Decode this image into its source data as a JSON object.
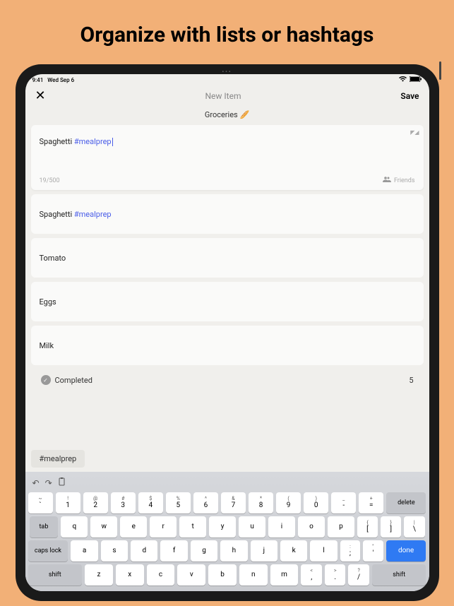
{
  "headline": "Organize with lists or hashtags",
  "statusbar": {
    "time": "9:41",
    "date": "Wed Sep 6"
  },
  "navbar": {
    "close": "✕",
    "title": "New Item",
    "save": "Save"
  },
  "list_title": "Groceries 🥖",
  "editor": {
    "text": "Spaghetti ",
    "hashtag": "#mealprep",
    "count": "19/500",
    "audience": "Friends"
  },
  "items": [
    {
      "text": "Spaghetti ",
      "hashtag": "#mealprep"
    },
    {
      "text": "Tomato",
      "hashtag": ""
    },
    {
      "text": "Eggs",
      "hashtag": ""
    },
    {
      "text": "Milk",
      "hashtag": ""
    }
  ],
  "completed": {
    "label": "Completed",
    "count": "5"
  },
  "suggestion": "#mealprep",
  "keyboard": {
    "row0": [
      {
        "t": "~",
        "m": "`"
      },
      {
        "t": "!",
        "m": "1"
      },
      {
        "t": "@",
        "m": "2"
      },
      {
        "t": "#",
        "m": "3"
      },
      {
        "t": "$",
        "m": "4"
      },
      {
        "t": "%",
        "m": "5"
      },
      {
        "t": "^",
        "m": "6"
      },
      {
        "t": "&",
        "m": "7"
      },
      {
        "t": "*",
        "m": "8"
      },
      {
        "t": "(",
        "m": "9"
      },
      {
        "t": ")",
        "m": "0"
      },
      {
        "t": "_",
        "m": "-"
      },
      {
        "t": "+",
        "m": "="
      }
    ],
    "delete": "delete",
    "row1": [
      "q",
      "w",
      "e",
      "r",
      "t",
      "y",
      "u",
      "i",
      "o",
      "p"
    ],
    "row1_extra": [
      {
        "t": "{",
        "m": "["
      },
      {
        "t": "}",
        "m": "]"
      },
      {
        "t": "|",
        "m": "\\"
      }
    ],
    "tab": "tab",
    "row2": [
      "a",
      "s",
      "d",
      "f",
      "g",
      "h",
      "j",
      "k",
      "l"
    ],
    "row2_extra": [
      {
        "t": ":",
        "m": ";"
      },
      {
        "t": "\"",
        "m": "'"
      }
    ],
    "capslock": "caps lock",
    "done": "done",
    "row3": [
      "z",
      "x",
      "c",
      "v",
      "b",
      "n",
      "m"
    ],
    "row3_extra": [
      {
        "t": "<",
        "m": ","
      },
      {
        "t": ">",
        "m": "."
      },
      {
        "t": "?",
        "m": "/"
      }
    ],
    "shift": "shift"
  }
}
